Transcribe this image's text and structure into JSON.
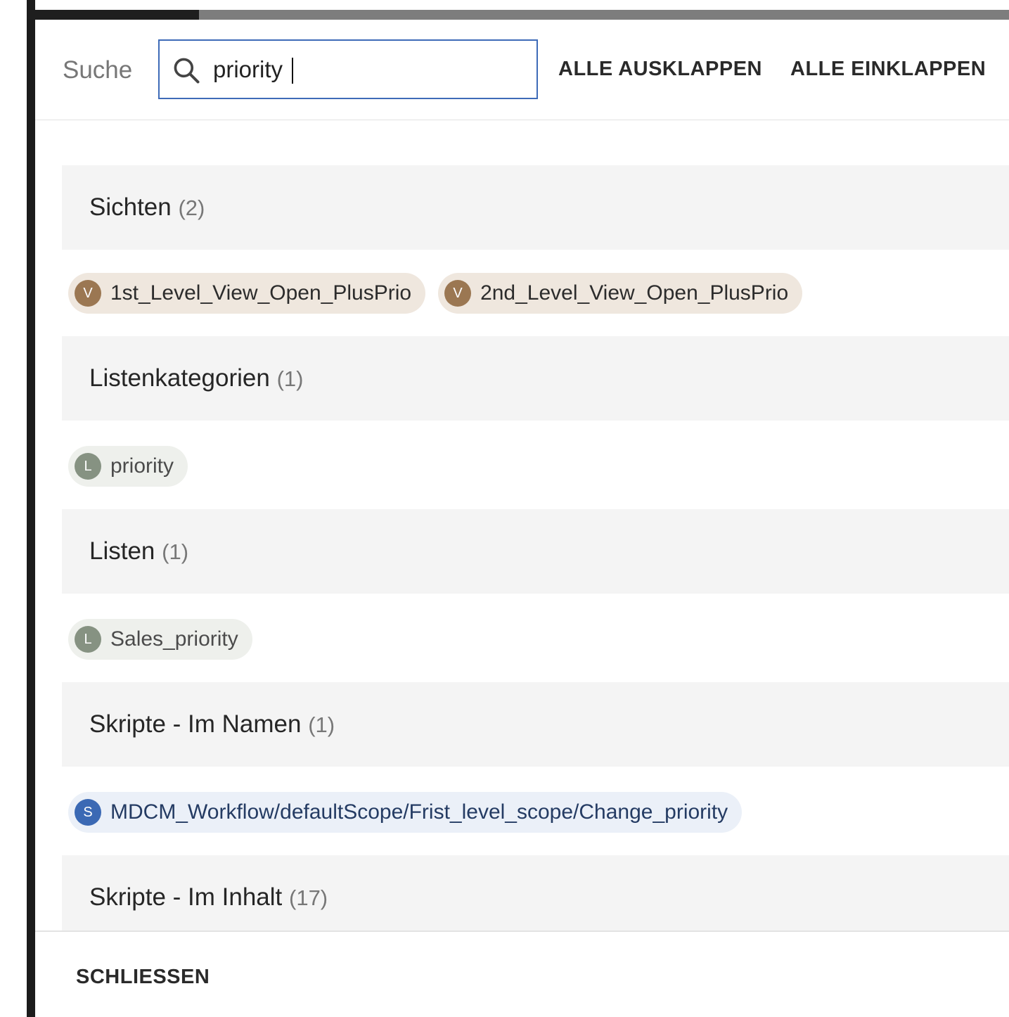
{
  "header": {
    "search_label": "Suche",
    "search_value": "priority",
    "expand_all_label": "ALLE AUSKLAPPEN",
    "collapse_all_label": "ALLE EINKLAPPEN"
  },
  "sections": [
    {
      "title": "Sichten",
      "count": "(2)",
      "items": [
        {
          "badge": "V",
          "label": "1st_Level_View_Open_PlusPrio",
          "type": "view"
        },
        {
          "badge": "V",
          "label": "2nd_Level_View_Open_PlusPrio",
          "type": "view"
        }
      ]
    },
    {
      "title": "Listenkategorien",
      "count": "(1)",
      "items": [
        {
          "badge": "L",
          "label": "priority",
          "type": "list"
        }
      ]
    },
    {
      "title": "Listen",
      "count": "(1)",
      "items": [
        {
          "badge": "L",
          "label": "Sales_priority",
          "type": "list"
        }
      ]
    },
    {
      "title": "Skripte - Im Namen",
      "count": "(1)",
      "items": [
        {
          "badge": "S",
          "label": "MDCM_Workflow/defaultScope/Frist_level_scope/Change_priority",
          "type": "script"
        }
      ]
    },
    {
      "title": "Skripte - Im Inhalt",
      "count": "(17)",
      "items": []
    }
  ],
  "footer": {
    "close_label": "SCHLIESSEN"
  },
  "colors": {
    "accent_border": "#3e6bb8",
    "view_badge": "#9b7752",
    "list_badge": "#869282",
    "script_badge": "#3b69b4"
  }
}
